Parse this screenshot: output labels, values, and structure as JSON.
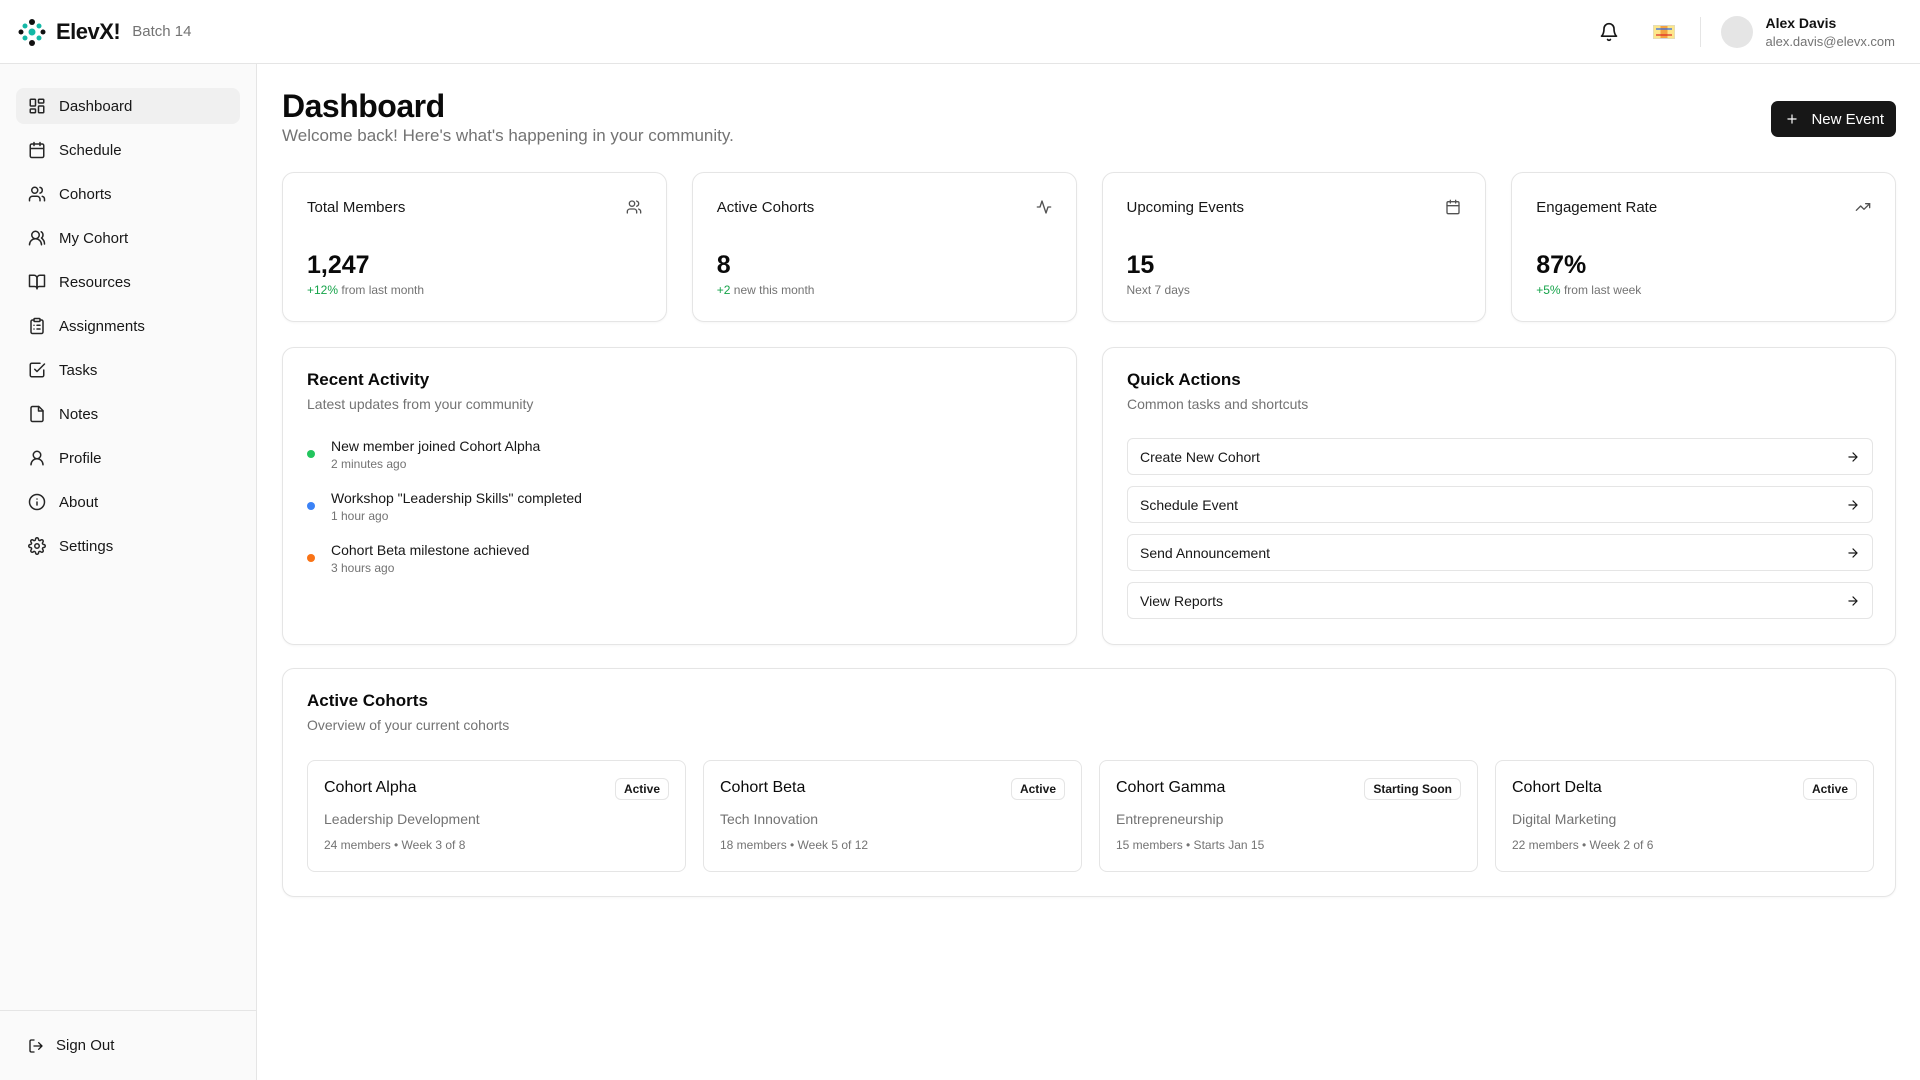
{
  "header": {
    "brand_name": "ElevX!",
    "batch": "Batch 14",
    "user": {
      "name": "Alex Davis",
      "email": "alex.davis@elevx.com"
    },
    "icons": [
      "bell-icon",
      "flag-icon"
    ]
  },
  "sidebar": {
    "items": [
      {
        "label": "Dashboard",
        "icon": "dashboard-icon",
        "active": true
      },
      {
        "label": "Schedule",
        "icon": "calendar-icon"
      },
      {
        "label": "Cohorts",
        "icon": "users-icon"
      },
      {
        "label": "My Cohort",
        "icon": "user-group-icon"
      },
      {
        "label": "Resources",
        "icon": "book-icon"
      },
      {
        "label": "Assignments",
        "icon": "clipboard-icon"
      },
      {
        "label": "Tasks",
        "icon": "checkbox-icon"
      },
      {
        "label": "Notes",
        "icon": "note-icon"
      },
      {
        "label": "Profile",
        "icon": "user-icon"
      },
      {
        "label": "About",
        "icon": "info-icon"
      },
      {
        "label": "Settings",
        "icon": "gear-icon"
      }
    ],
    "sign_out": "Sign Out"
  },
  "page": {
    "title": "Dashboard",
    "subtitle": "Welcome back! Here's what's happening in your community.",
    "new_event_label": "New Event"
  },
  "stats": [
    {
      "title": "Total Members",
      "value": "1,247",
      "delta": "+12%",
      "note": " from last month",
      "icon": "users-icon"
    },
    {
      "title": "Active Cohorts",
      "value": "8",
      "delta": "+2",
      "note": " new this month",
      "icon": "activity-icon"
    },
    {
      "title": "Upcoming Events",
      "value": "15",
      "delta": "",
      "note": "Next 7 days",
      "icon": "calendar-icon"
    },
    {
      "title": "Engagement Rate",
      "value": "87%",
      "delta": "+5%",
      "note": " from last week",
      "icon": "trending-up-icon"
    }
  ],
  "recent_activity": {
    "title": "Recent Activity",
    "subtitle": "Latest updates from your community",
    "items": [
      {
        "text": "New member joined Cohort Alpha",
        "time": "2 minutes ago",
        "color": "#22c55e"
      },
      {
        "text": "Workshop \"Leadership Skills\" completed",
        "time": "1 hour ago",
        "color": "#3b82f6"
      },
      {
        "text": "Cohort Beta milestone achieved",
        "time": "3 hours ago",
        "color": "#f97316"
      }
    ]
  },
  "quick_actions": {
    "title": "Quick Actions",
    "subtitle": "Common tasks and shortcuts",
    "items": [
      "Create New Cohort",
      "Schedule Event",
      "Send Announcement",
      "View Reports"
    ]
  },
  "active_cohorts": {
    "title": "Active Cohorts",
    "subtitle": "Overview of your current cohorts",
    "items": [
      {
        "name": "Cohort Alpha",
        "status": "Active",
        "track": "Leadership Development",
        "meta": "24 members • Week 3 of 8"
      },
      {
        "name": "Cohort Beta",
        "status": "Active",
        "track": "Tech Innovation",
        "meta": "18 members • Week 5 of 12"
      },
      {
        "name": "Cohort Gamma",
        "status": "Starting Soon",
        "track": "Entrepreneurship",
        "meta": "15 members • Starts Jan 15"
      },
      {
        "name": "Cohort Delta",
        "status": "Active",
        "track": "Digital Marketing",
        "meta": "22 members • Week 2 of 6"
      }
    ]
  }
}
